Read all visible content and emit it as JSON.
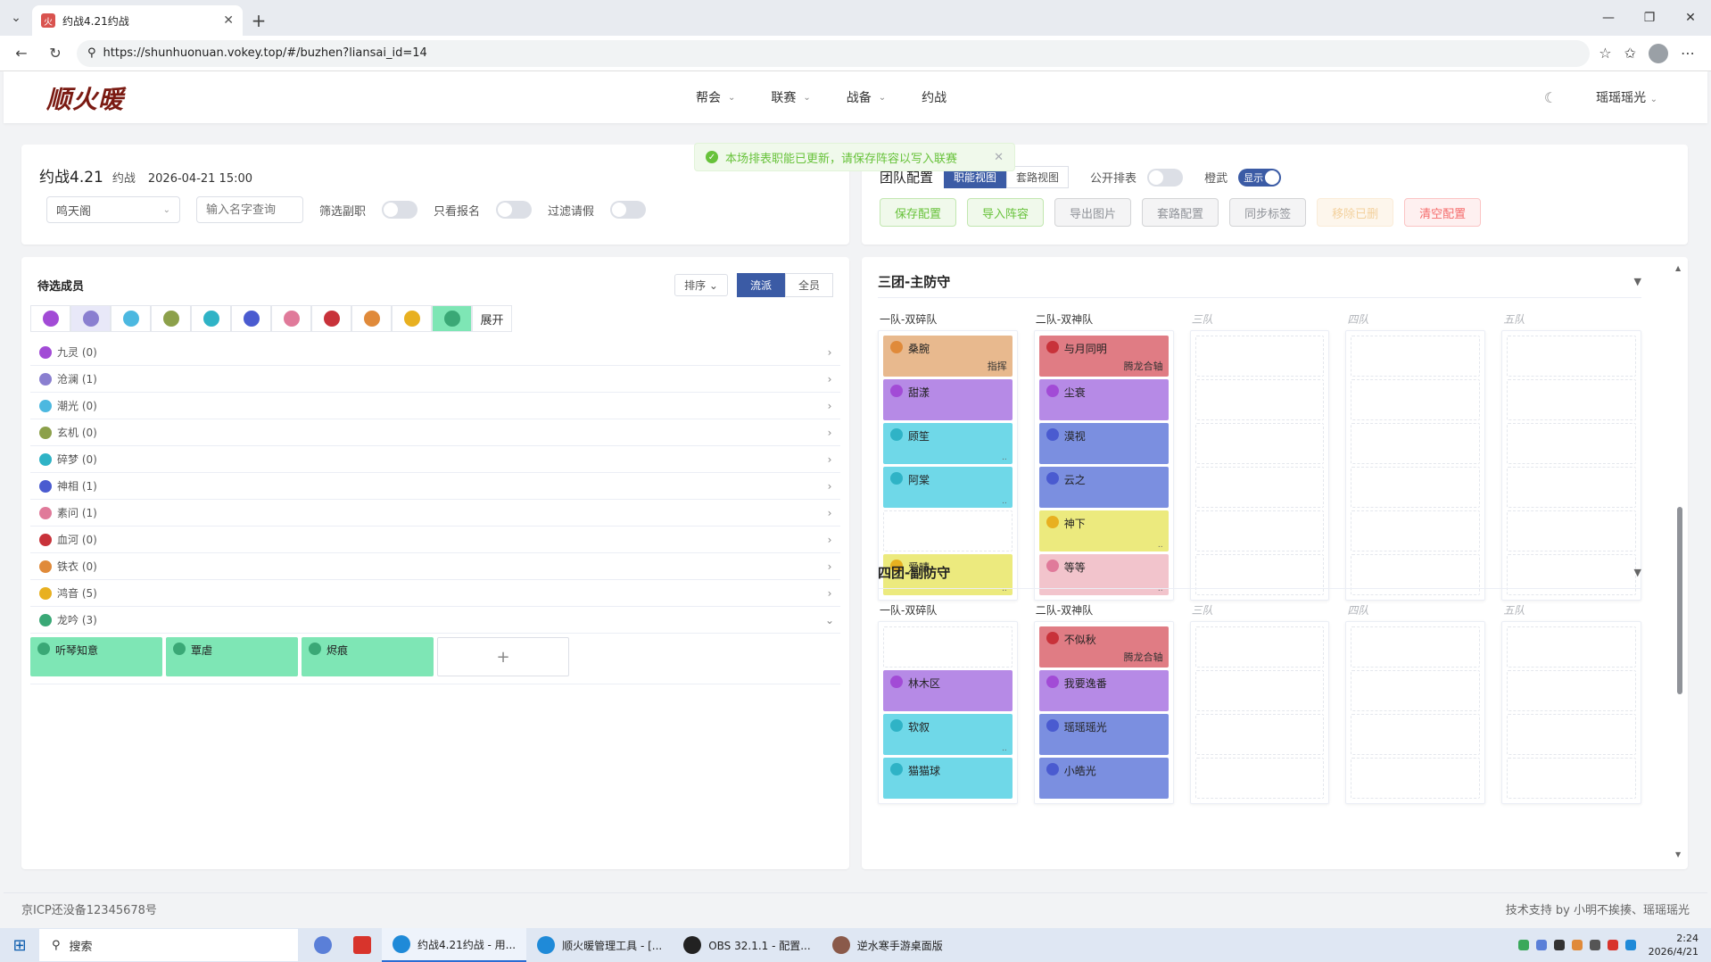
{
  "browser": {
    "tab_title": "约战4.21约战",
    "url": "https://shunhuonuan.vokey.top/#/buzhen?liansai_id=14"
  },
  "app": {
    "logo_text": "顺火暖",
    "nav": [
      "帮会",
      "联赛",
      "战备",
      "约战"
    ],
    "user": "瑶瑶瑶光"
  },
  "toast": {
    "message": "本场排表职能已更新，请保存阵容以写入联赛"
  },
  "info": {
    "name": "约战4.21",
    "tag": "约战",
    "time": "2026-04-21 15:00",
    "select_value": "鸣天阁",
    "search_placeholder": "输入名字查询",
    "filter_sub": "筛选副职",
    "filter_signup": "只看报名",
    "filter_leave": "过滤请假"
  },
  "config": {
    "title": "团队配置",
    "view_tabs": [
      "职能视图",
      "套路视图"
    ],
    "public_label": "公开排表",
    "orange_label": "橙武",
    "orange_switch": "显示",
    "buttons": [
      "保存配置",
      "导入阵容",
      "导出图片",
      "套路配置",
      "同步标签",
      "移除已删",
      "清空配置"
    ]
  },
  "members": {
    "title": "待选成员",
    "sort_label": "排序",
    "tabs": [
      "流派",
      "全员"
    ],
    "expand_label": "展开",
    "sections": [
      {
        "label": "九灵 (0)",
        "color": "#a24bd6"
      },
      {
        "label": "沧澜 (1)",
        "color": "#8a7fd0"
      },
      {
        "label": "潮光 (0)",
        "color": "#4cb8e0"
      },
      {
        "label": "玄机 (0)",
        "color": "#8ca04a"
      },
      {
        "label": "碎梦 (0)",
        "color": "#2fb3c6"
      },
      {
        "label": "神相 (1)",
        "color": "#4a5bd0"
      },
      {
        "label": "素问 (1)",
        "color": "#e07a9a"
      },
      {
        "label": "血河 (0)",
        "color": "#c8323a"
      },
      {
        "label": "铁衣 (0)",
        "color": "#e08a3a"
      },
      {
        "label": "鸿音 (5)",
        "color": "#e8b020"
      },
      {
        "label": "龙吟 (3)",
        "color": "#3aa876"
      }
    ],
    "open_cards": [
      "听琴知意",
      "覃虐",
      "烬痕"
    ],
    "add_symbol": "+"
  },
  "teams": [
    {
      "title": "三团-主防守",
      "columns": [
        {
          "label": "一队-双碎队",
          "slots": [
            {
              "name": "桑腕",
              "role": "指挥",
              "color": "#e8b98e",
              "dot": "#e08a3a"
            },
            {
              "name": "甜漾",
              "role": "",
              "color": "#b68ae6",
              "dot": "#a24bd6"
            },
            {
              "name": "顾笙",
              "role": "",
              "mini": "..",
              "color": "#6fd8e8",
              "dot": "#2fb3c6"
            },
            {
              "name": "阿棠",
              "role": "",
              "mini": "..",
              "color": "#6fd8e8",
              "dot": "#2fb3c6"
            },
            null,
            {
              "name": "爱晴",
              "role": "",
              "mini": "..",
              "color": "#ecea7e",
              "dot": "#e8b020"
            }
          ]
        },
        {
          "label": "二队-双神队",
          "slots": [
            {
              "name": "与月同明",
              "role": "腾龙合轴",
              "color": "#e07c84",
              "dot": "#c8323a"
            },
            {
              "name": "尘衰",
              "role": "",
              "color": "#b68ae6",
              "dot": "#a24bd6"
            },
            {
              "name": "漠视",
              "role": "",
              "color": "#7b8fe0",
              "dot": "#4a5bd0"
            },
            {
              "name": "云之",
              "role": "",
              "color": "#7b8fe0",
              "dot": "#4a5bd0"
            },
            {
              "name": "神下",
              "role": "",
              "mini": "..",
              "color": "#ecea7e",
              "dot": "#e8b020"
            },
            {
              "name": "等等",
              "role": "",
              "mini": "..",
              "color": "#f2c4cc",
              "dot": "#e07a9a"
            }
          ]
        },
        {
          "label": "三队",
          "dim": true,
          "slots": [
            null,
            null,
            null,
            null,
            null,
            null
          ]
        },
        {
          "label": "四队",
          "dim": true,
          "slots": [
            null,
            null,
            null,
            null,
            null,
            null
          ]
        },
        {
          "label": "五队",
          "dim": true,
          "slots": [
            null,
            null,
            null,
            null,
            null,
            null
          ]
        }
      ]
    },
    {
      "title": "四团-副防守",
      "columns": [
        {
          "label": "一队-双碎队",
          "slots": [
            null,
            {
              "name": "林木区",
              "role": "",
              "color": "#b68ae6",
              "dot": "#a24bd6"
            },
            {
              "name": "软叙",
              "role": "",
              "mini": "..",
              "color": "#6fd8e8",
              "dot": "#2fb3c6"
            },
            {
              "name": "猫猫球",
              "role": "",
              "color": "#6fd8e8",
              "dot": "#2fb3c6"
            }
          ]
        },
        {
          "label": "二队-双神队",
          "slots": [
            {
              "name": "不似秋",
              "role": "腾龙合轴",
              "color": "#e07c84",
              "dot": "#c8323a"
            },
            {
              "name": "我要逸番",
              "role": "",
              "color": "#b68ae6",
              "dot": "#a24bd6"
            },
            {
              "name": "瑶瑶瑶光",
              "role": "",
              "color": "#7b8fe0",
              "dot": "#4a5bd0"
            },
            {
              "name": "小皓光",
              "role": "",
              "color": "#7b8fe0",
              "dot": "#4a5bd0"
            }
          ]
        },
        {
          "label": "三队",
          "dim": true,
          "slots": [
            null,
            null,
            null,
            null
          ]
        },
        {
          "label": "四队",
          "dim": true,
          "slots": [
            null,
            null,
            null,
            null
          ]
        },
        {
          "label": "五队",
          "dim": true,
          "slots": [
            null,
            null,
            null,
            null
          ]
        }
      ]
    }
  ],
  "footer": {
    "icp": "京ICP还没备12345678号",
    "credits": "技术支持 by  小明不挨揍、瑶瑶瑶光"
  },
  "taskbar": {
    "search_label": "搜索",
    "apps": [
      "约战4.21约战 - 用...",
      "顺火暖管理工具 - [...",
      "OBS 32.1.1 - 配置...",
      "逆水寒手游桌面版"
    ],
    "time": "2:24",
    "date": "2026/4/21"
  }
}
